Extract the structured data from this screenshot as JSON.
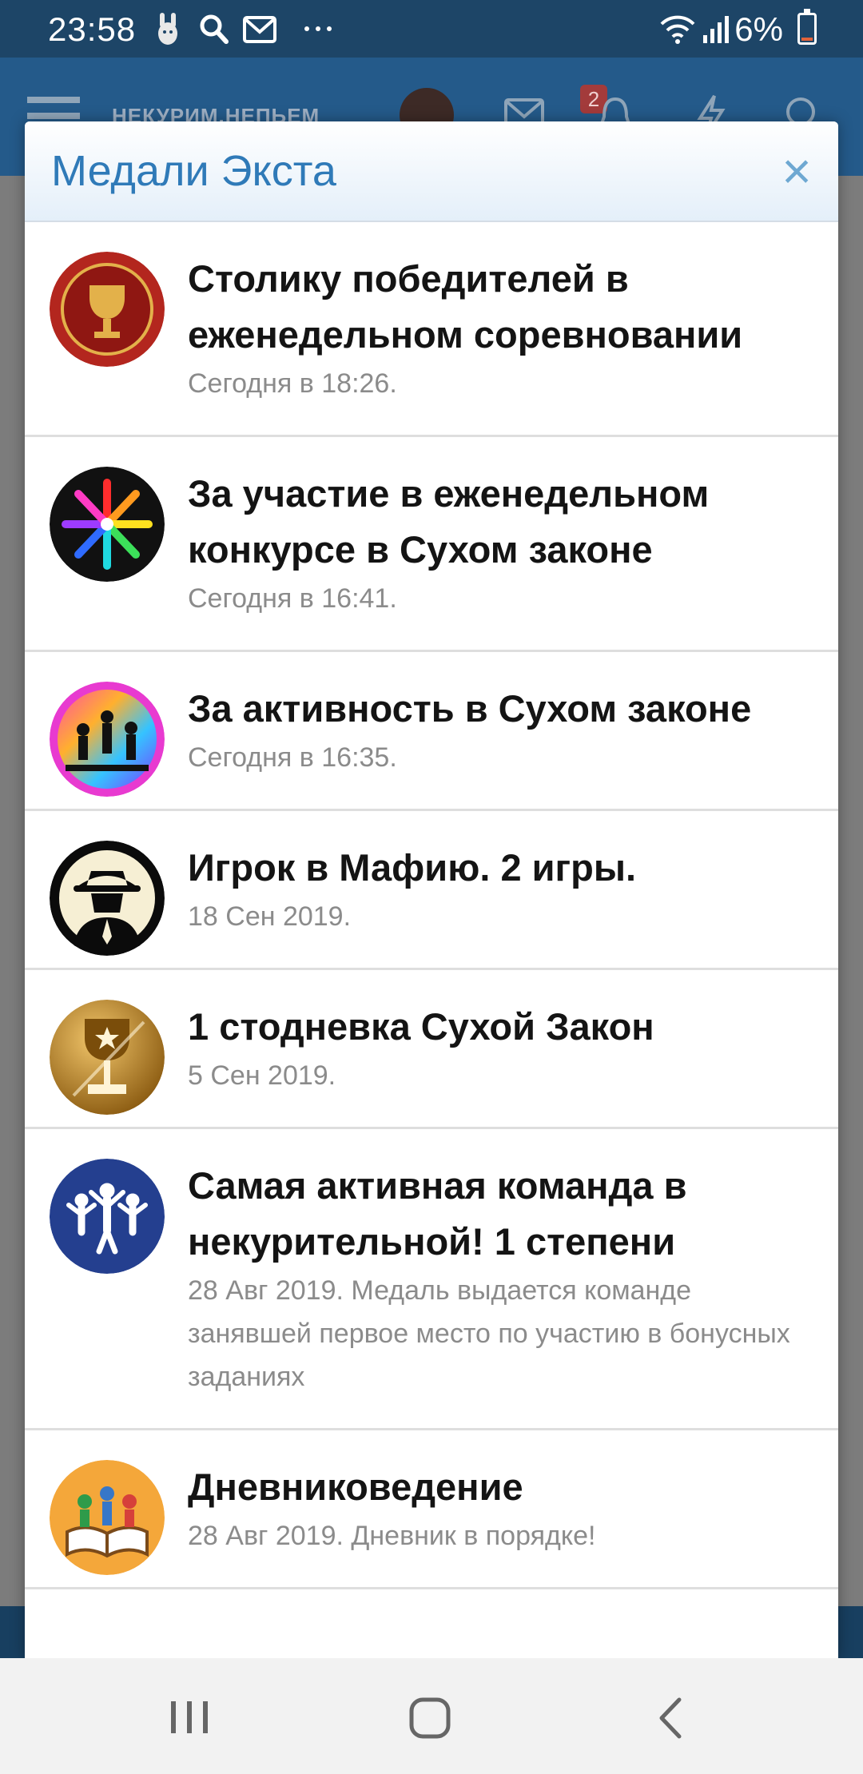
{
  "status_bar": {
    "time": "23:58",
    "battery_text": "6%",
    "battery_level": 0.06,
    "icons": [
      "app-notification-icon",
      "search-icon",
      "mail-icon",
      "more-icon",
      "wifi-icon",
      "signal-icon",
      "battery-icon"
    ]
  },
  "app_header": {
    "logo_text": "НЕКУРИМ.НЕПЬЕМ",
    "notification_count": "2",
    "icons": [
      "menu-icon",
      "avatar",
      "mail-icon",
      "bell-icon",
      "lightning-icon",
      "search-icon"
    ]
  },
  "modal": {
    "title": "Медали Экста",
    "close_label": "×",
    "medals": [
      {
        "title": "Столику победителей в еженедельном соревновании",
        "meta": "Сегодня в 18:26.",
        "icon": "trophy-medal-icon"
      },
      {
        "title": "За участие в еженедельном конкурсе в Сухом законе",
        "meta": "Сегодня в 16:41.",
        "icon": "rainbow-wheel-medal-icon"
      },
      {
        "title": "За активность в Сухом законе",
        "meta": "Сегодня в 16:35.",
        "icon": "dancers-medal-icon"
      },
      {
        "title": "Игрок в Мафию. 2 игры.",
        "meta": "18 Сен 2019.",
        "icon": "mafia-medal-icon"
      },
      {
        "title": "1 стодневка Сухой Закон",
        "meta": "5 Сен 2019.",
        "icon": "gold-cup-medal-icon"
      },
      {
        "title": "Самая активная команда в некурительной! 1 степени",
        "meta": "28 Авг 2019. Медаль выдается команде занявшей первое место по участию в бонусных заданиях",
        "icon": "team-medal-icon"
      },
      {
        "title": "Дневниковедение",
        "meta": "28 Авг 2019. Дневник в порядке!",
        "icon": "diary-medal-icon"
      }
    ]
  },
  "colors": {
    "status_bar": "#1d4567",
    "header": "#245a8a",
    "modal_title": "#2f7ab8",
    "close": "#6ea8d2",
    "meta_text": "#8b8b8b"
  }
}
